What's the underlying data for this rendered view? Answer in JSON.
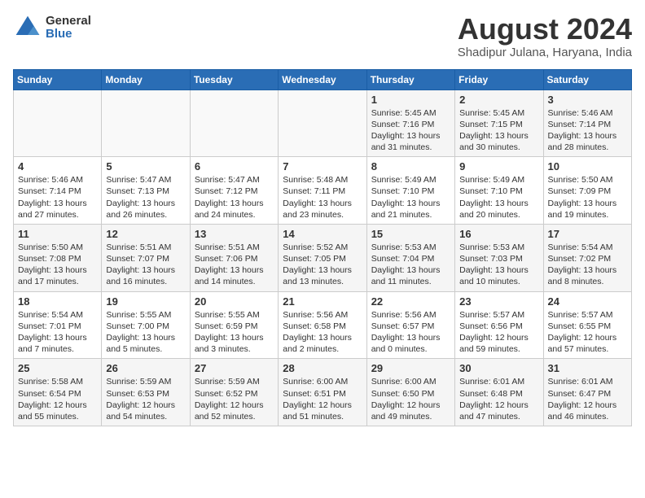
{
  "header": {
    "logo_general": "General",
    "logo_blue": "Blue",
    "month_title": "August 2024",
    "location": "Shadipur Julana, Haryana, India"
  },
  "days_of_week": [
    "Sunday",
    "Monday",
    "Tuesday",
    "Wednesday",
    "Thursday",
    "Friday",
    "Saturday"
  ],
  "weeks": [
    {
      "days": [
        {
          "number": "",
          "lines": []
        },
        {
          "number": "",
          "lines": []
        },
        {
          "number": "",
          "lines": []
        },
        {
          "number": "",
          "lines": []
        },
        {
          "number": "1",
          "lines": [
            "Sunrise: 5:45 AM",
            "Sunset: 7:16 PM",
            "Daylight: 13 hours",
            "and 31 minutes."
          ]
        },
        {
          "number": "2",
          "lines": [
            "Sunrise: 5:45 AM",
            "Sunset: 7:15 PM",
            "Daylight: 13 hours",
            "and 30 minutes."
          ]
        },
        {
          "number": "3",
          "lines": [
            "Sunrise: 5:46 AM",
            "Sunset: 7:14 PM",
            "Daylight: 13 hours",
            "and 28 minutes."
          ]
        }
      ]
    },
    {
      "days": [
        {
          "number": "4",
          "lines": [
            "Sunrise: 5:46 AM",
            "Sunset: 7:14 PM",
            "Daylight: 13 hours",
            "and 27 minutes."
          ]
        },
        {
          "number": "5",
          "lines": [
            "Sunrise: 5:47 AM",
            "Sunset: 7:13 PM",
            "Daylight: 13 hours",
            "and 26 minutes."
          ]
        },
        {
          "number": "6",
          "lines": [
            "Sunrise: 5:47 AM",
            "Sunset: 7:12 PM",
            "Daylight: 13 hours",
            "and 24 minutes."
          ]
        },
        {
          "number": "7",
          "lines": [
            "Sunrise: 5:48 AM",
            "Sunset: 7:11 PM",
            "Daylight: 13 hours",
            "and 23 minutes."
          ]
        },
        {
          "number": "8",
          "lines": [
            "Sunrise: 5:49 AM",
            "Sunset: 7:10 PM",
            "Daylight: 13 hours",
            "and 21 minutes."
          ]
        },
        {
          "number": "9",
          "lines": [
            "Sunrise: 5:49 AM",
            "Sunset: 7:10 PM",
            "Daylight: 13 hours",
            "and 20 minutes."
          ]
        },
        {
          "number": "10",
          "lines": [
            "Sunrise: 5:50 AM",
            "Sunset: 7:09 PM",
            "Daylight: 13 hours",
            "and 19 minutes."
          ]
        }
      ]
    },
    {
      "days": [
        {
          "number": "11",
          "lines": [
            "Sunrise: 5:50 AM",
            "Sunset: 7:08 PM",
            "Daylight: 13 hours",
            "and 17 minutes."
          ]
        },
        {
          "number": "12",
          "lines": [
            "Sunrise: 5:51 AM",
            "Sunset: 7:07 PM",
            "Daylight: 13 hours",
            "and 16 minutes."
          ]
        },
        {
          "number": "13",
          "lines": [
            "Sunrise: 5:51 AM",
            "Sunset: 7:06 PM",
            "Daylight: 13 hours",
            "and 14 minutes."
          ]
        },
        {
          "number": "14",
          "lines": [
            "Sunrise: 5:52 AM",
            "Sunset: 7:05 PM",
            "Daylight: 13 hours",
            "and 13 minutes."
          ]
        },
        {
          "number": "15",
          "lines": [
            "Sunrise: 5:53 AM",
            "Sunset: 7:04 PM",
            "Daylight: 13 hours",
            "and 11 minutes."
          ]
        },
        {
          "number": "16",
          "lines": [
            "Sunrise: 5:53 AM",
            "Sunset: 7:03 PM",
            "Daylight: 13 hours",
            "and 10 minutes."
          ]
        },
        {
          "number": "17",
          "lines": [
            "Sunrise: 5:54 AM",
            "Sunset: 7:02 PM",
            "Daylight: 13 hours",
            "and 8 minutes."
          ]
        }
      ]
    },
    {
      "days": [
        {
          "number": "18",
          "lines": [
            "Sunrise: 5:54 AM",
            "Sunset: 7:01 PM",
            "Daylight: 13 hours",
            "and 7 minutes."
          ]
        },
        {
          "number": "19",
          "lines": [
            "Sunrise: 5:55 AM",
            "Sunset: 7:00 PM",
            "Daylight: 13 hours",
            "and 5 minutes."
          ]
        },
        {
          "number": "20",
          "lines": [
            "Sunrise: 5:55 AM",
            "Sunset: 6:59 PM",
            "Daylight: 13 hours",
            "and 3 minutes."
          ]
        },
        {
          "number": "21",
          "lines": [
            "Sunrise: 5:56 AM",
            "Sunset: 6:58 PM",
            "Daylight: 13 hours",
            "and 2 minutes."
          ]
        },
        {
          "number": "22",
          "lines": [
            "Sunrise: 5:56 AM",
            "Sunset: 6:57 PM",
            "Daylight: 13 hours",
            "and 0 minutes."
          ]
        },
        {
          "number": "23",
          "lines": [
            "Sunrise: 5:57 AM",
            "Sunset: 6:56 PM",
            "Daylight: 12 hours",
            "and 59 minutes."
          ]
        },
        {
          "number": "24",
          "lines": [
            "Sunrise: 5:57 AM",
            "Sunset: 6:55 PM",
            "Daylight: 12 hours",
            "and 57 minutes."
          ]
        }
      ]
    },
    {
      "days": [
        {
          "number": "25",
          "lines": [
            "Sunrise: 5:58 AM",
            "Sunset: 6:54 PM",
            "Daylight: 12 hours",
            "and 55 minutes."
          ]
        },
        {
          "number": "26",
          "lines": [
            "Sunrise: 5:59 AM",
            "Sunset: 6:53 PM",
            "Daylight: 12 hours",
            "and 54 minutes."
          ]
        },
        {
          "number": "27",
          "lines": [
            "Sunrise: 5:59 AM",
            "Sunset: 6:52 PM",
            "Daylight: 12 hours",
            "and 52 minutes."
          ]
        },
        {
          "number": "28",
          "lines": [
            "Sunrise: 6:00 AM",
            "Sunset: 6:51 PM",
            "Daylight: 12 hours",
            "and 51 minutes."
          ]
        },
        {
          "number": "29",
          "lines": [
            "Sunrise: 6:00 AM",
            "Sunset: 6:50 PM",
            "Daylight: 12 hours",
            "and 49 minutes."
          ]
        },
        {
          "number": "30",
          "lines": [
            "Sunrise: 6:01 AM",
            "Sunset: 6:48 PM",
            "Daylight: 12 hours",
            "and 47 minutes."
          ]
        },
        {
          "number": "31",
          "lines": [
            "Sunrise: 6:01 AM",
            "Sunset: 6:47 PM",
            "Daylight: 12 hours",
            "and 46 minutes."
          ]
        }
      ]
    }
  ]
}
